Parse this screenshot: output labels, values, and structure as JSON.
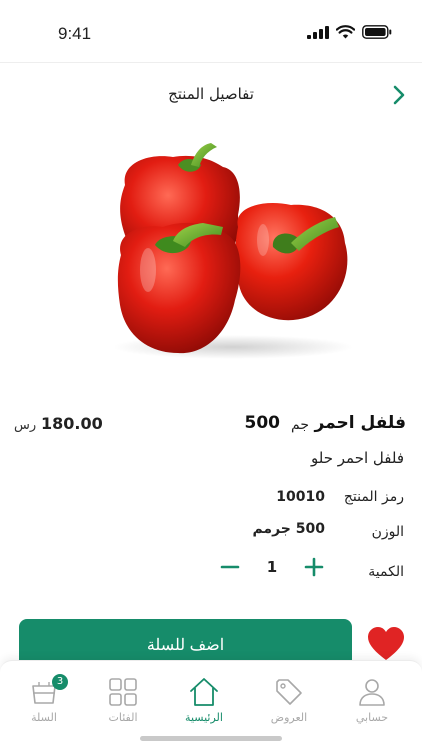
{
  "status_bar": {
    "time": "9:41"
  },
  "header": {
    "title": "تفاصيل المنتج"
  },
  "product": {
    "name": "فلفل احمر",
    "weight_number": "500",
    "weight_unit": "جم",
    "price": "180.00",
    "currency": "رس",
    "subtitle": "فلفل احمر حلو",
    "details": {
      "code_label": "رمز المنتج",
      "code_value": "10010",
      "weight_label": "الوزن",
      "weight_value": "500 جرمم",
      "quantity_label": "الكمية",
      "quantity_value": "1"
    }
  },
  "actions": {
    "add_to_cart": "اضف للسلة"
  },
  "bottom_nav": {
    "items": [
      {
        "label": "السلة",
        "icon": "cart-icon",
        "badge": "3"
      },
      {
        "label": "الفئات",
        "icon": "categories-grid-icon"
      },
      {
        "label": "الرئيسية",
        "icon": "home-icon",
        "active": true
      },
      {
        "label": "العروض",
        "icon": "tag-icon"
      },
      {
        "label": "حسابي",
        "icon": "user-icon"
      }
    ]
  },
  "colors": {
    "accent": "#168c6a",
    "heart": "#e02424",
    "inactive": "#a8a8a8"
  }
}
